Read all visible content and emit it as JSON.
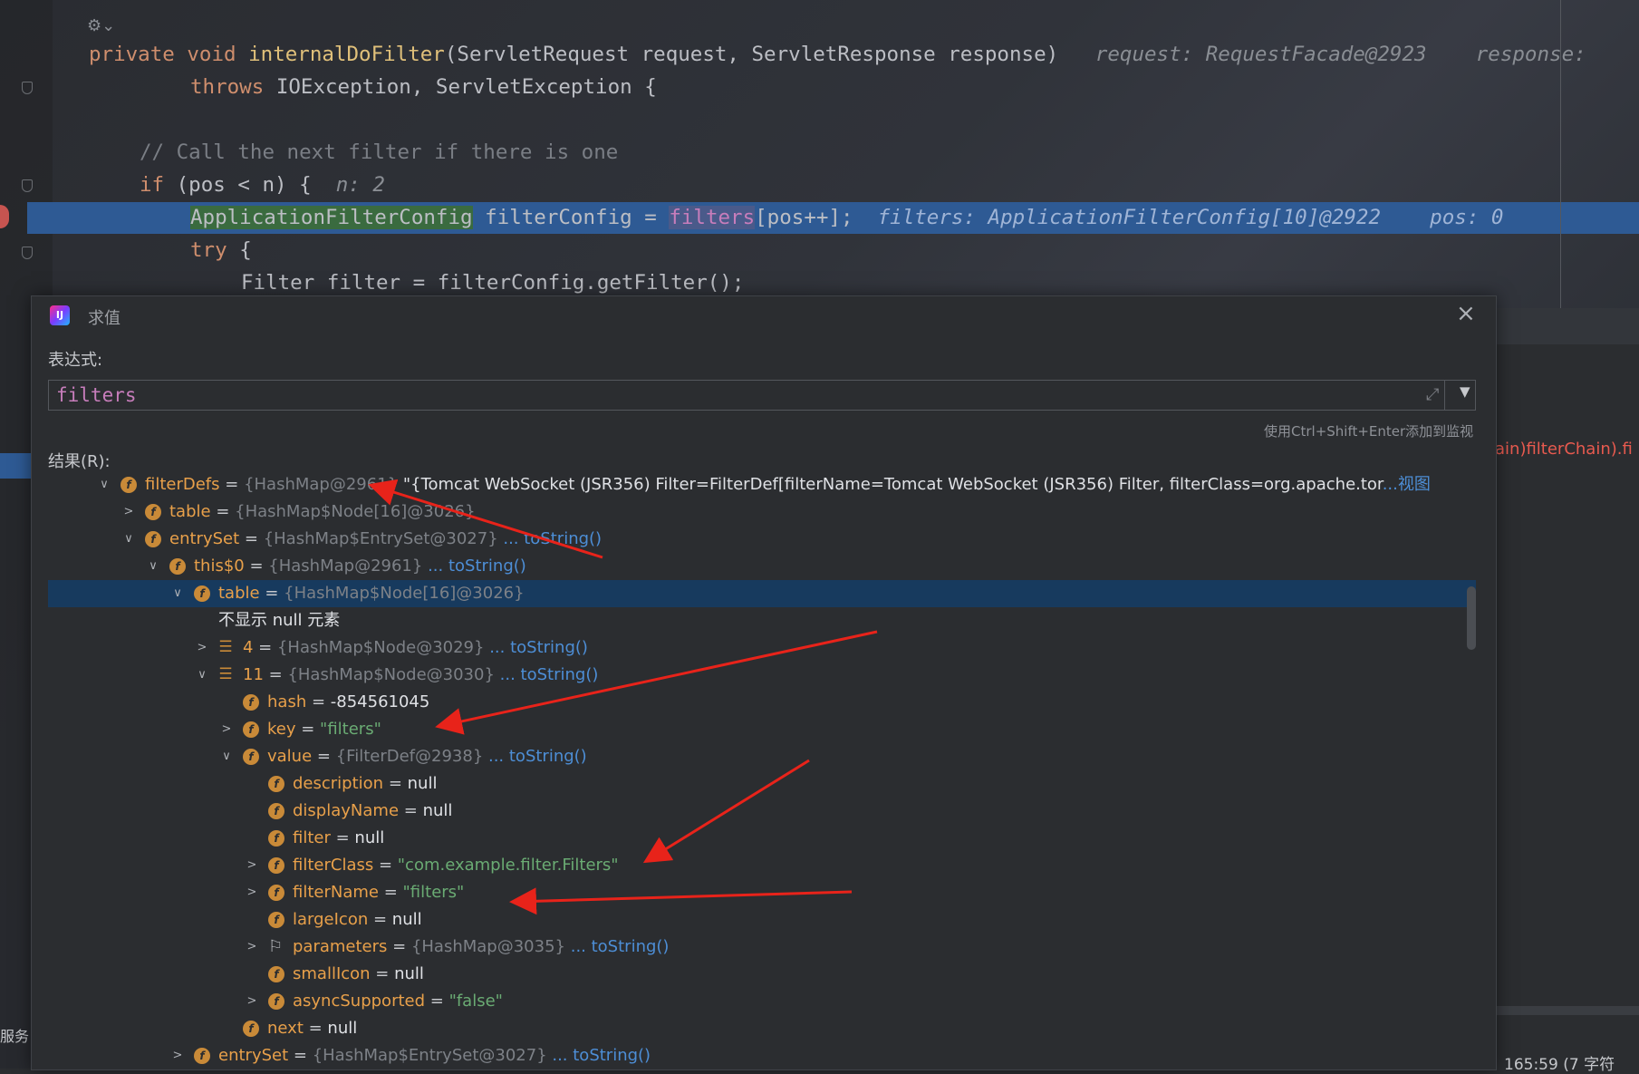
{
  "editor": {
    "lines": {
      "l1": {
        "kw": "private void ",
        "fn": "internalDoFilter",
        "params": "(ServletRequest request, ServletResponse response)",
        "inlay": "request: RequestFacade@2923    response: "
      },
      "l2": {
        "kw": "throws ",
        "rest": "IOException, ServletException {"
      },
      "l3": {
        "comment": "// Call the next filter if there is one"
      },
      "l4": {
        "kw": "if ",
        "cond": "(pos < n) {",
        "inlay": "n: 2"
      },
      "l5": {
        "type": "ApplicationFilterConfig",
        "mid": " filterConfig = ",
        "field": "filters",
        "rest": "[pos++];",
        "inlay": "filters: ApplicationFilterConfig[10]@2922    pos: 0"
      },
      "l6": {
        "kw": "try ",
        "rest": "{"
      },
      "l7": {
        "code": "Filter filter = filterConfig.getFilter();"
      }
    },
    "right_code": "ain)filterChain).fi",
    "status": "165:59 (7 字符",
    "left_label": "服务"
  },
  "dialog": {
    "title": "求值",
    "expression_label": "表达式:",
    "expression": "filters",
    "hint": "使用Ctrl+Shift+Enter添加到监视",
    "result_label": "结果(R):",
    "rows": [
      {
        "chev": "∨",
        "icon": "f",
        "name": "filterDefs",
        "eq": " = ",
        "type": "{HashMap@2961}",
        "value": " \"{Tomcat WebSocket (JSR356) Filter=FilterDef[filterName=Tomcat WebSocket (JSR356) Filter, filterClass=org.apache.tor",
        "link": "...视图"
      },
      {
        "chev": ">",
        "icon": "f",
        "name": "table",
        "eq": " = ",
        "type": "{HashMap$Node[16]@3026}"
      },
      {
        "chev": "∨",
        "icon": "f",
        "name": "entrySet",
        "eq": " = ",
        "type": "{HashMap$EntrySet@3027}",
        "link": " ... toString()"
      },
      {
        "chev": "∨",
        "icon": "f",
        "name": "this$0",
        "eq": " = ",
        "type": "{HashMap@2961}",
        "link": " ... toString()"
      },
      {
        "chev": "∨",
        "icon": "f",
        "name": "table",
        "eq": " = ",
        "type": "{HashMap$Node[16]@3026}"
      },
      {
        "plain": "不显示 null 元素"
      },
      {
        "chev": ">",
        "icon": "a",
        "name": "4",
        "eq": " = ",
        "type": "{HashMap$Node@3029}",
        "link": " ... toString()"
      },
      {
        "chev": "∨",
        "icon": "a",
        "name": "11",
        "eq": " = ",
        "type": "{HashMap$Node@3030}",
        "link": " ... toString()"
      },
      {
        "icon": "f",
        "name": "hash",
        "eq": " = ",
        "val": "-854561045"
      },
      {
        "chev": ">",
        "icon": "f",
        "name": "key",
        "eq": " = ",
        "str": "\"filters\""
      },
      {
        "chev": "∨",
        "icon": "f",
        "name": "value",
        "eq": " = ",
        "type": "{FilterDef@2938}",
        "link": " ... toString()"
      },
      {
        "icon": "f",
        "name": "description",
        "eq": " = ",
        "val": "null"
      },
      {
        "icon": "f",
        "name": "displayName",
        "eq": " = ",
        "val": "null"
      },
      {
        "icon": "f",
        "name": "filter",
        "eq": " = ",
        "val": "null"
      },
      {
        "chev": ">",
        "icon": "f",
        "name": "filterClass",
        "eq": " = ",
        "str": "\"com.example.filter.Filters\""
      },
      {
        "chev": ">",
        "icon": "f",
        "name": "filterName",
        "eq": " = ",
        "str": "\"filters\""
      },
      {
        "icon": "f",
        "name": "largeIcon",
        "eq": " = ",
        "val": "null"
      },
      {
        "chev": ">",
        "icon": "flag",
        "name": "parameters",
        "eq": " = ",
        "type": "{HashMap@3035}",
        "link": " ... toString()"
      },
      {
        "icon": "f",
        "name": "smallIcon",
        "eq": " = ",
        "val": "null"
      },
      {
        "chev": ">",
        "icon": "f",
        "name": "asyncSupported",
        "eq": " = ",
        "str": "\"false\""
      },
      {
        "icon": "f",
        "name": "next",
        "eq": " = ",
        "val": "null"
      },
      {
        "chev": ">",
        "icon": "f",
        "name": "entrySet",
        "eq": " = ",
        "type": "{HashMap$EntrySet@3027}",
        "link": " ... toString()"
      }
    ]
  },
  "colors": {
    "selection": "#173a5e",
    "annotation_arrow": "#e8231a",
    "field_icon": "#c98a38"
  }
}
